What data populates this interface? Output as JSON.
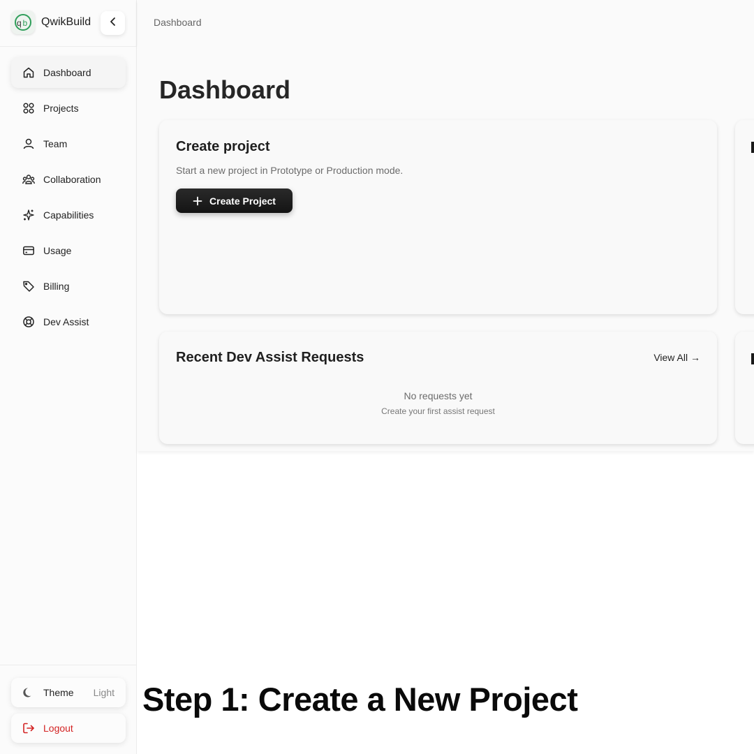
{
  "brand": {
    "name": "QwikBuild"
  },
  "sidebar": {
    "items": [
      {
        "label": "Dashboard",
        "icon": "home-icon",
        "active": true
      },
      {
        "label": "Projects",
        "icon": "grid-icon"
      },
      {
        "label": "Team",
        "icon": "users-icon"
      },
      {
        "label": "Collaboration",
        "icon": "group-icon"
      },
      {
        "label": "Capabilities",
        "icon": "sparkles-icon"
      },
      {
        "label": "Usage",
        "icon": "credit-card-icon"
      },
      {
        "label": "Billing",
        "icon": "tag-icon"
      },
      {
        "label": "Dev Assist",
        "icon": "lifebuoy-icon"
      }
    ],
    "theme": {
      "label": "Theme",
      "value": "Light",
      "icon": "moon-icon"
    },
    "logout": {
      "label": "Logout",
      "icon": "logout-icon",
      "color": "#d32222"
    }
  },
  "topbar": {
    "breadcrumb": "Dashboard"
  },
  "main": {
    "title": "Dashboard",
    "create_card": {
      "title": "Create project",
      "description": "Start a new project in Prototype or Production mode.",
      "button_label": "Create Project"
    },
    "requests_card": {
      "title": "Recent Dev Assist Requests",
      "view_all": "View All →",
      "empty_title": "No requests yet",
      "empty_subtitle": "Create your first assist request"
    }
  },
  "caption": "Step 1: Create a New Project"
}
